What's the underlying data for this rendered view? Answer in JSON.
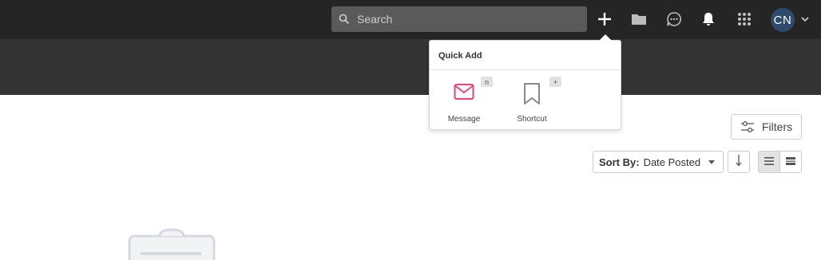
{
  "topbar": {
    "search": {
      "placeholder": "Search"
    },
    "icons": [
      "search-icon",
      "plus-icon",
      "folder-icon",
      "chat-icon",
      "bell-icon",
      "apps-grid-icon",
      "chevron-down-icon"
    ],
    "avatar": {
      "initials": "CN",
      "color": "#2f4a6b"
    }
  },
  "quick_add": {
    "title": "Quick Add",
    "items": [
      {
        "label": "Message",
        "shortcut": "n",
        "icon": "envelope-icon",
        "color": "#e0457b"
      },
      {
        "label": "Shortcut",
        "shortcut": "+",
        "icon": "bookmark-icon",
        "color": "#8a8a8a"
      }
    ]
  },
  "toolbar": {
    "filters_label": "Filters",
    "sort_label": "Sort By:",
    "sort_value": "Date Posted",
    "sort_direction_icon": "arrow-down-icon",
    "view_modes": [
      "list-view-icon",
      "compact-view-icon"
    ],
    "active_view": "list-view-icon"
  },
  "colors": {
    "topbar_bg": "#252525",
    "subbar_bg": "#343434",
    "search_bg": "#5a5a5a",
    "accent": "#e0457b"
  }
}
